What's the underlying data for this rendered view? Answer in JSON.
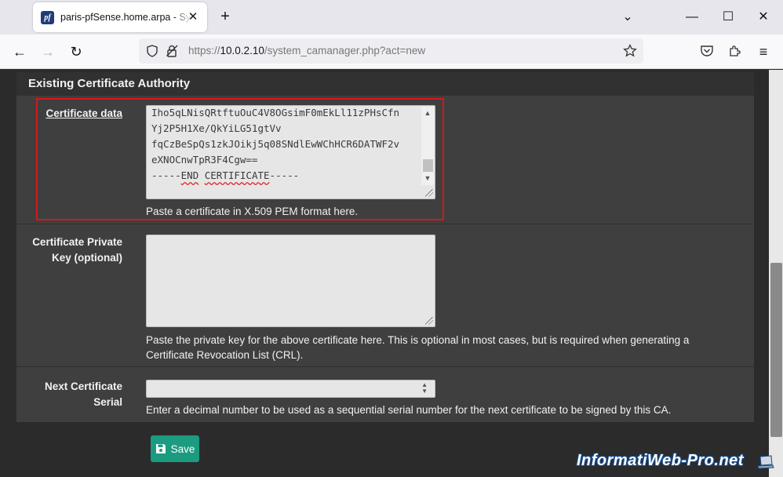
{
  "browser": {
    "tab_title": "paris-pfSense.home.arpa - System: Certificates: Authorities",
    "favicon_text": "pf",
    "url_prefix": "https://",
    "url_host": "10.0.2.10",
    "url_path": "/system_camanager.php?act=new"
  },
  "section": {
    "title": "Existing Certificate Authority"
  },
  "fields": {
    "certificate_data": {
      "label": "Certificate data",
      "lines": [
        "Iho5qLNisQRtftuOuC4V8OGsimF0mEkLl11zPHsCfn",
        "Yj2P5H1Xe/QkYiLG51gtVv",
        "fqCzBeSpQs1zkJOikj5q08SNdlEwWChHCR6DATWF2v",
        "eXNOCnwTpR3F4Cgw==",
        "-----",
        "END",
        " ",
        "CERTIFICATE",
        "-----"
      ],
      "help": "Paste a certificate in X.509 PEM format here."
    },
    "private_key": {
      "label_line1": "Certificate Private",
      "label_line2": "Key (optional)",
      "help_line1": "Paste the private key for the above certificate here. This is optional in most cases, but is required when generating a",
      "help_line2": "Certificate Revocation List (CRL)."
    },
    "next_serial": {
      "label_line1": "Next Certificate",
      "label_line2": "Serial",
      "help": "Enter a decimal number to be used as a sequential serial number for the next certificate to be signed by this CA."
    }
  },
  "actions": {
    "save_label": "Save"
  },
  "watermark": {
    "text": "InformatiWeb-Pro.net"
  },
  "colors": {
    "accent": "#1b9b80",
    "highlight": "#d51818",
    "panel": "#3f3f3f"
  }
}
